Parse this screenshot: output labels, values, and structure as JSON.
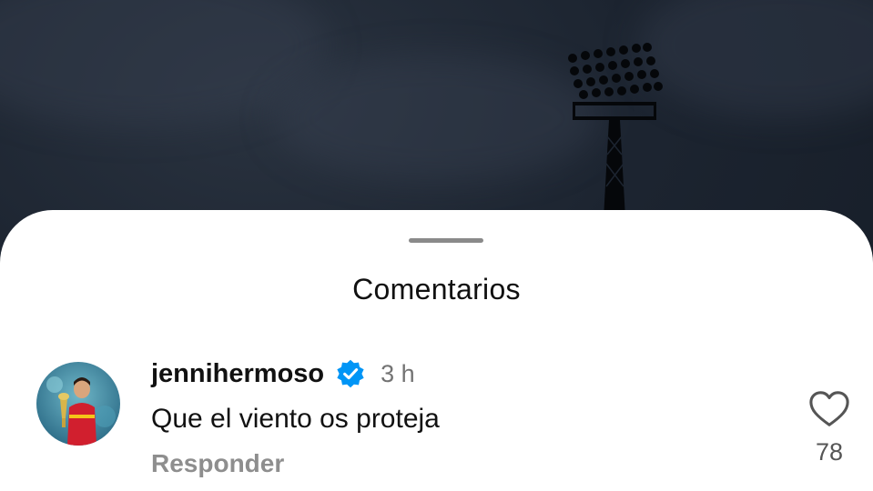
{
  "sheet": {
    "title": "Comentarios"
  },
  "comment": {
    "username": "jennihermoso",
    "time": "3 h",
    "text": "Que el viento os proteja",
    "reply_label": "Responder",
    "likes": "78",
    "verified": true
  },
  "icons": {
    "verified": "verified-badge-icon",
    "like": "heart-outline-icon"
  },
  "colors": {
    "verified_badge": "#0095f6",
    "sky": "#1c2430",
    "sheet_bg": "#ffffff",
    "muted_text": "#8e8e8e"
  }
}
